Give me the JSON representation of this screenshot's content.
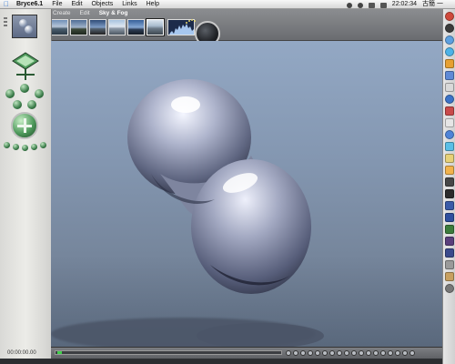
{
  "menubar": {
    "apple_glyph": "",
    "app_name": "Bryce6.1",
    "items": [
      "File",
      "Edit",
      "Objects",
      "Links",
      "Help"
    ],
    "clock": "22:02:34",
    "input_method": "古簡 一 "
  },
  "palette": {
    "tabs": [
      "Create",
      "Edit",
      "Sky & Fog"
    ],
    "active_tab": "Sky & Fog",
    "presets": [
      "sky-preset-1",
      "sky-preset-2",
      "sky-preset-3",
      "sky-preset-4",
      "sky-preset-5",
      "sky-preset-6",
      "sky-preset-7"
    ]
  },
  "status": {
    "time_readout": "00:00:00.00"
  },
  "icons": {
    "render": "render-knob-icon",
    "trackball": "trackball-icon",
    "camera": "camera-cross-icon",
    "select": "select-tool-icon"
  },
  "colors": {
    "sky": "#8a9db7",
    "object": "#8f96b3",
    "panel": "#e2e2df",
    "timeline_dot": "#3fcf4a"
  },
  "dock": {
    "items": [
      {
        "color": "#d04a3c",
        "shape": "round"
      },
      {
        "color": "#3b3b3b",
        "shape": "round"
      },
      {
        "color": "#5da0e0",
        "shape": "round"
      },
      {
        "color": "#4db3e8",
        "shape": "round"
      },
      {
        "color": "#e6a032",
        "shape": "square"
      },
      {
        "color": "#5f8ad6",
        "shape": "square"
      },
      {
        "color": "#d9d9d9",
        "shape": "square"
      },
      {
        "color": "#3b73c8",
        "shape": "round"
      },
      {
        "color": "#c94a4a",
        "shape": "square"
      },
      {
        "color": "#e6e6e6",
        "shape": "square"
      },
      {
        "color": "#4f84d8",
        "shape": "round"
      },
      {
        "color": "#5bbfe6",
        "shape": "square"
      },
      {
        "color": "#e7d178",
        "shape": "square"
      },
      {
        "color": "#f2b34c",
        "shape": "square"
      },
      {
        "color": "#474747",
        "shape": "square"
      },
      {
        "color": "#2b2b2b",
        "shape": "square"
      },
      {
        "color": "#3a5ba8",
        "shape": "square"
      },
      {
        "color": "#2f4f9e",
        "shape": "square"
      },
      {
        "color": "#3c7c3c",
        "shape": "square"
      },
      {
        "color": "#5a3f7c",
        "shape": "square"
      },
      {
        "color": "#3a4a8c",
        "shape": "square"
      },
      {
        "color": "#9a9a9a",
        "shape": "square"
      },
      {
        "color": "#c8a060",
        "shape": "square"
      },
      {
        "color": "#777777",
        "shape": "round"
      }
    ]
  }
}
